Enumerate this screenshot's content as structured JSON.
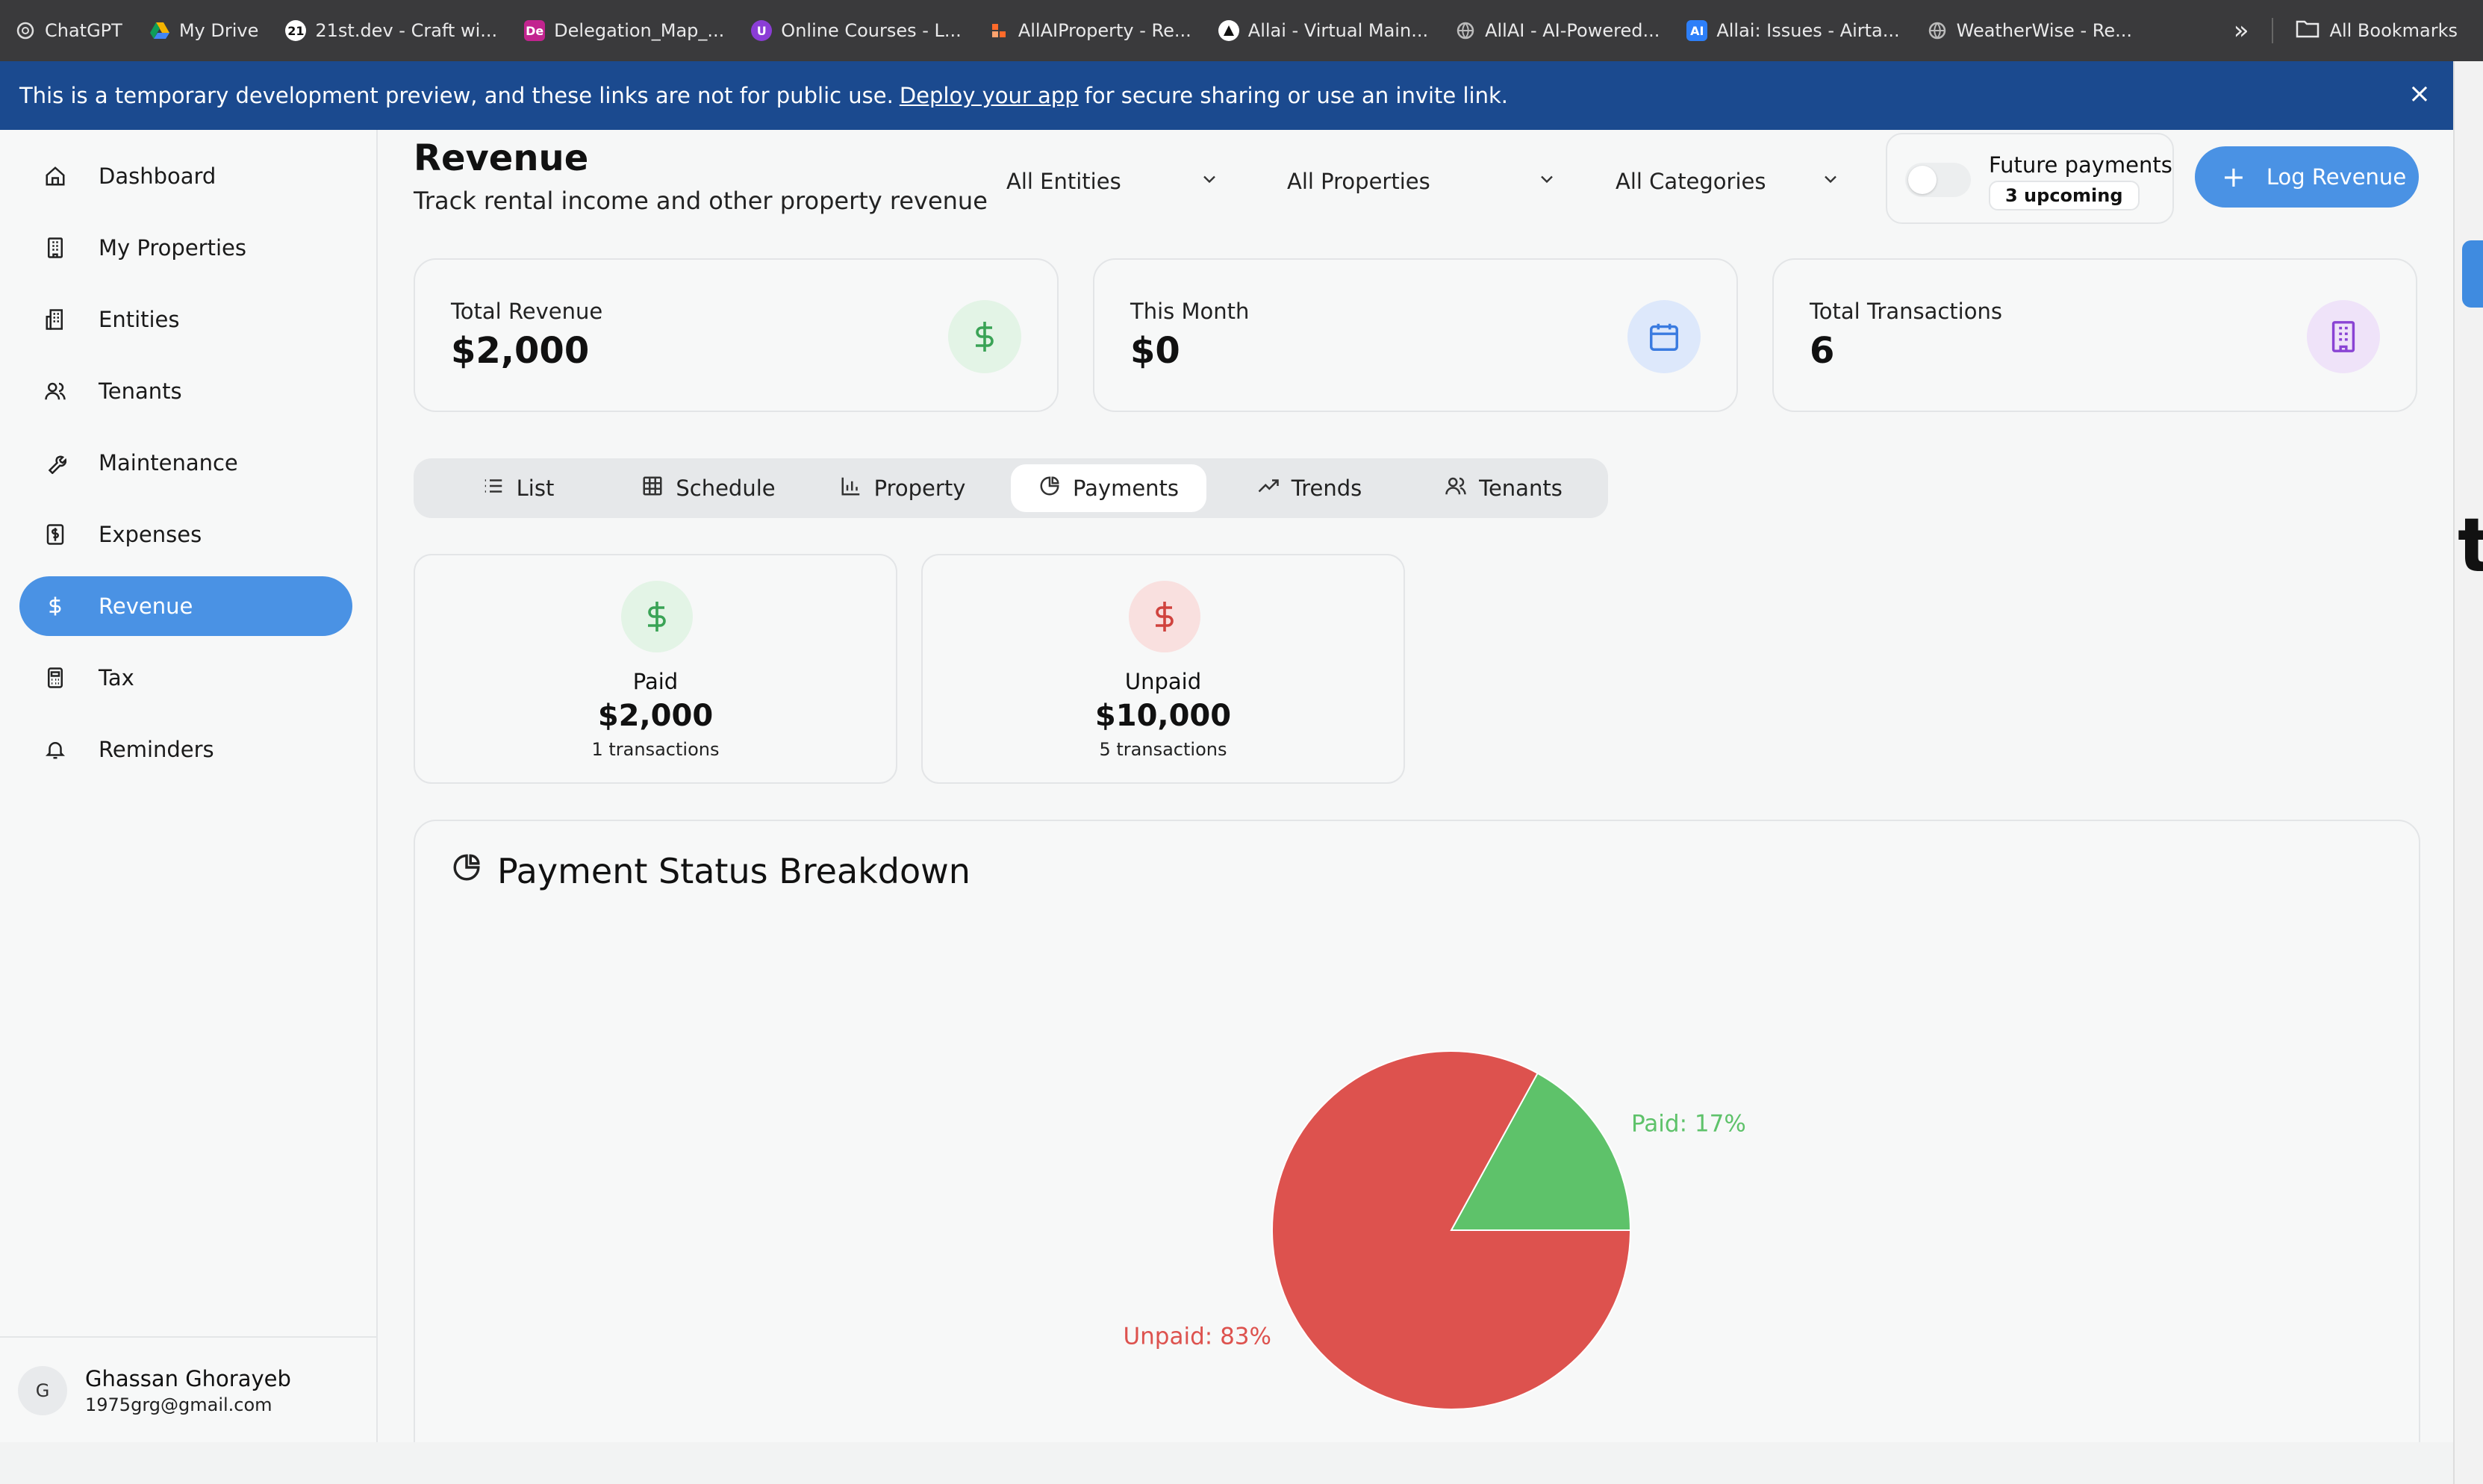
{
  "bookmarks": [
    {
      "label": "ChatGPT",
      "icon": "chatgpt-icon",
      "color": "#3a3a3c"
    },
    {
      "label": "My Drive",
      "icon": "drive-icon",
      "color": "#f4b400"
    },
    {
      "label": "21st.dev - Craft wi...",
      "icon": "21st-icon",
      "color": "#ffffff"
    },
    {
      "label": "Delegation_Map_...",
      "icon": "de-icon",
      "color": "#c2248f"
    },
    {
      "label": "Online Courses - L...",
      "icon": "courses-icon",
      "color": "#8b3dd6"
    },
    {
      "label": "AllAIProperty - Re...",
      "icon": "property-icon",
      "color": "#ff6a2a"
    },
    {
      "label": "Allai - Virtual Main...",
      "icon": "allai-icon",
      "color": "#ffffff"
    },
    {
      "label": "AllAI - AI-Powered...",
      "icon": "globe-icon",
      "color": "#bbbbbb"
    },
    {
      "label": "Allai: Issues - Airta...",
      "icon": "airtable-icon",
      "color": "#2d7ff9"
    },
    {
      "label": "WeatherWise - Re...",
      "icon": "globe-icon",
      "color": "#bbbbbb"
    }
  ],
  "bookmarks_more": "»",
  "all_bookmarks": "All Bookmarks",
  "banner": {
    "text_before": "This is a temporary development preview, and these links are not for public use.",
    "link": "Deploy your app",
    "text_after": "for secure sharing or use an invite link.",
    "close": "×"
  },
  "sidebar": {
    "items": [
      {
        "label": "Dashboard",
        "icon": "home-icon",
        "active": false
      },
      {
        "label": "My Properties",
        "icon": "building-icon",
        "active": false
      },
      {
        "label": "Entities",
        "icon": "entities-icon",
        "active": false
      },
      {
        "label": "Tenants",
        "icon": "users-icon",
        "active": false
      },
      {
        "label": "Maintenance",
        "icon": "wrench-icon",
        "active": false
      },
      {
        "label": "Expenses",
        "icon": "receipt-icon",
        "active": false
      },
      {
        "label": "Revenue",
        "icon": "dollar-icon",
        "active": true
      },
      {
        "label": "Tax",
        "icon": "calculator-icon",
        "active": false
      },
      {
        "label": "Reminders",
        "icon": "bell-icon",
        "active": false
      }
    ],
    "user": {
      "initial": "G",
      "name": "Ghassan Ghorayeb",
      "email": "1975grg@gmail.com"
    }
  },
  "header": {
    "title": "Revenue",
    "subtitle": "Track rental income and other property revenue",
    "filters": {
      "entities": "All Entities",
      "properties": "All Properties",
      "categories": "All Categories"
    },
    "future_payments": {
      "label": "Future payments",
      "badge": "3 upcoming",
      "enabled": false
    },
    "log_button": "Log Revenue"
  },
  "stats": [
    {
      "label": "Total Revenue",
      "value": "$2,000",
      "icon": "dollar-icon"
    },
    {
      "label": "This Month",
      "value": "$0",
      "icon": "calendar-icon"
    },
    {
      "label": "Total Transactions",
      "value": "6",
      "icon": "building-icon"
    }
  ],
  "tabs": [
    {
      "label": "List",
      "icon": "list-icon"
    },
    {
      "label": "Schedule",
      "icon": "grid-icon"
    },
    {
      "label": "Property",
      "icon": "bar-chart-icon"
    },
    {
      "label": "Payments",
      "icon": "pie-chart-icon",
      "active": true
    },
    {
      "label": "Trends",
      "icon": "trend-icon"
    },
    {
      "label": "Tenants",
      "icon": "users-icon"
    }
  ],
  "payments": {
    "paid": {
      "label": "Paid",
      "amount": "$2,000",
      "count": "1 transactions"
    },
    "unpaid": {
      "label": "Unpaid",
      "amount": "$10,000",
      "count": "5 transactions"
    }
  },
  "chart_title": "Payment Status Breakdown",
  "colors": {
    "accent": "#4a92e4",
    "paid": "#5ec26a",
    "unpaid": "#dd524e",
    "banner": "#1b4a8f"
  },
  "chart_data": {
    "type": "pie",
    "title": "Payment Status Breakdown",
    "slices": [
      {
        "label": "Paid",
        "value": 17,
        "display": "Paid: 17%",
        "color": "#5ec26a"
      },
      {
        "label": "Unpaid",
        "value": 83,
        "display": "Unpaid: 83%",
        "color": "#dd524e"
      }
    ]
  }
}
